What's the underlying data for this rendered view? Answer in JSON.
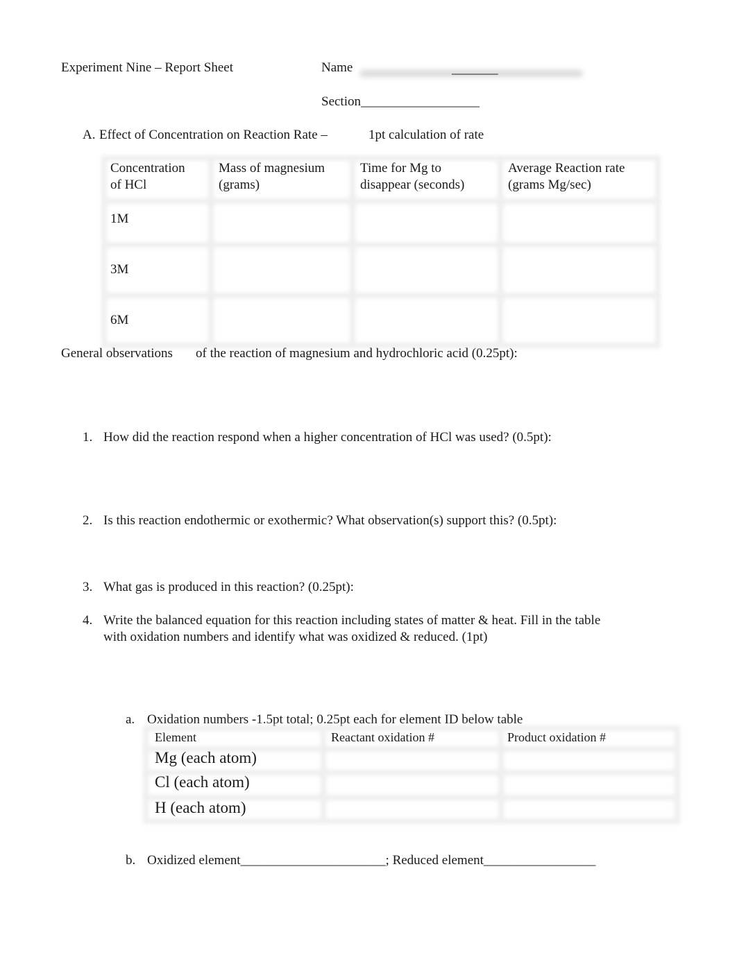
{
  "header": {
    "title": "Experiment Nine – Report Sheet",
    "name_label": "Name",
    "name_blank": "_______",
    "section_label": "Section",
    "section_blank": "__________________"
  },
  "section_a": {
    "marker": "A.",
    "title": "Effect of Concentration on Reaction Rate –",
    "points": "1pt calculation of rate",
    "table": {
      "headers": [
        [
          "Concentration",
          "of HCl"
        ],
        [
          "Mass of magnesium",
          "(grams)"
        ],
        [
          "Time for Mg to",
          "disappear (seconds)"
        ],
        [
          "Average Reaction rate",
          "(grams Mg/sec)"
        ]
      ],
      "rows": [
        {
          "concentration": "1M",
          "mass": "",
          "time": "",
          "rate": ""
        },
        {
          "concentration": "3M",
          "mass": "",
          "time": "",
          "rate": ""
        },
        {
          "concentration": "6M",
          "mass": "",
          "time": "",
          "rate": ""
        }
      ]
    }
  },
  "observations": {
    "label": "General observations",
    "text": "of the reaction of magnesium and hydrochloric acid (0.25pt):"
  },
  "questions": [
    {
      "number": "1.",
      "lines": [
        "How did the reaction respond when a higher concentration of HCl was used? (0.5pt):"
      ]
    },
    {
      "number": "2.",
      "lines": [
        "Is this reaction endothermic or exothermic?  What observation(s) support this? (0.5pt):"
      ]
    },
    {
      "number": "3.",
      "lines": [
        "What gas is produced in this reaction? (0.25pt):"
      ]
    },
    {
      "number": "4.",
      "lines": [
        "Write the balanced equation for this reaction including states of matter & heat.  Fill in the table",
        "with oxidation numbers and identify what was oxidized & reduced. (1pt)"
      ]
    }
  ],
  "subquestions": {
    "a": {
      "marker": "a.",
      "text": "Oxidation numbers -1.5pt total; 0.25pt each for element ID below table",
      "table": {
        "headers": [
          "Element",
          "Reactant oxidation #",
          "Product oxidation #"
        ],
        "rows": [
          {
            "element": "Mg (each atom)",
            "reactant": "",
            "product": ""
          },
          {
            "element": "Cl (each atom)",
            "reactant": "",
            "product": ""
          },
          {
            "element": "H (each atom)",
            "reactant": "",
            "product": ""
          }
        ]
      }
    },
    "b": {
      "marker": "b.",
      "oxidized_label": "Oxidized element",
      "oxidized_blank": "______________________",
      "separator": ";",
      "reduced_label": "Reduced element",
      "reduced_blank": "_________________"
    }
  }
}
